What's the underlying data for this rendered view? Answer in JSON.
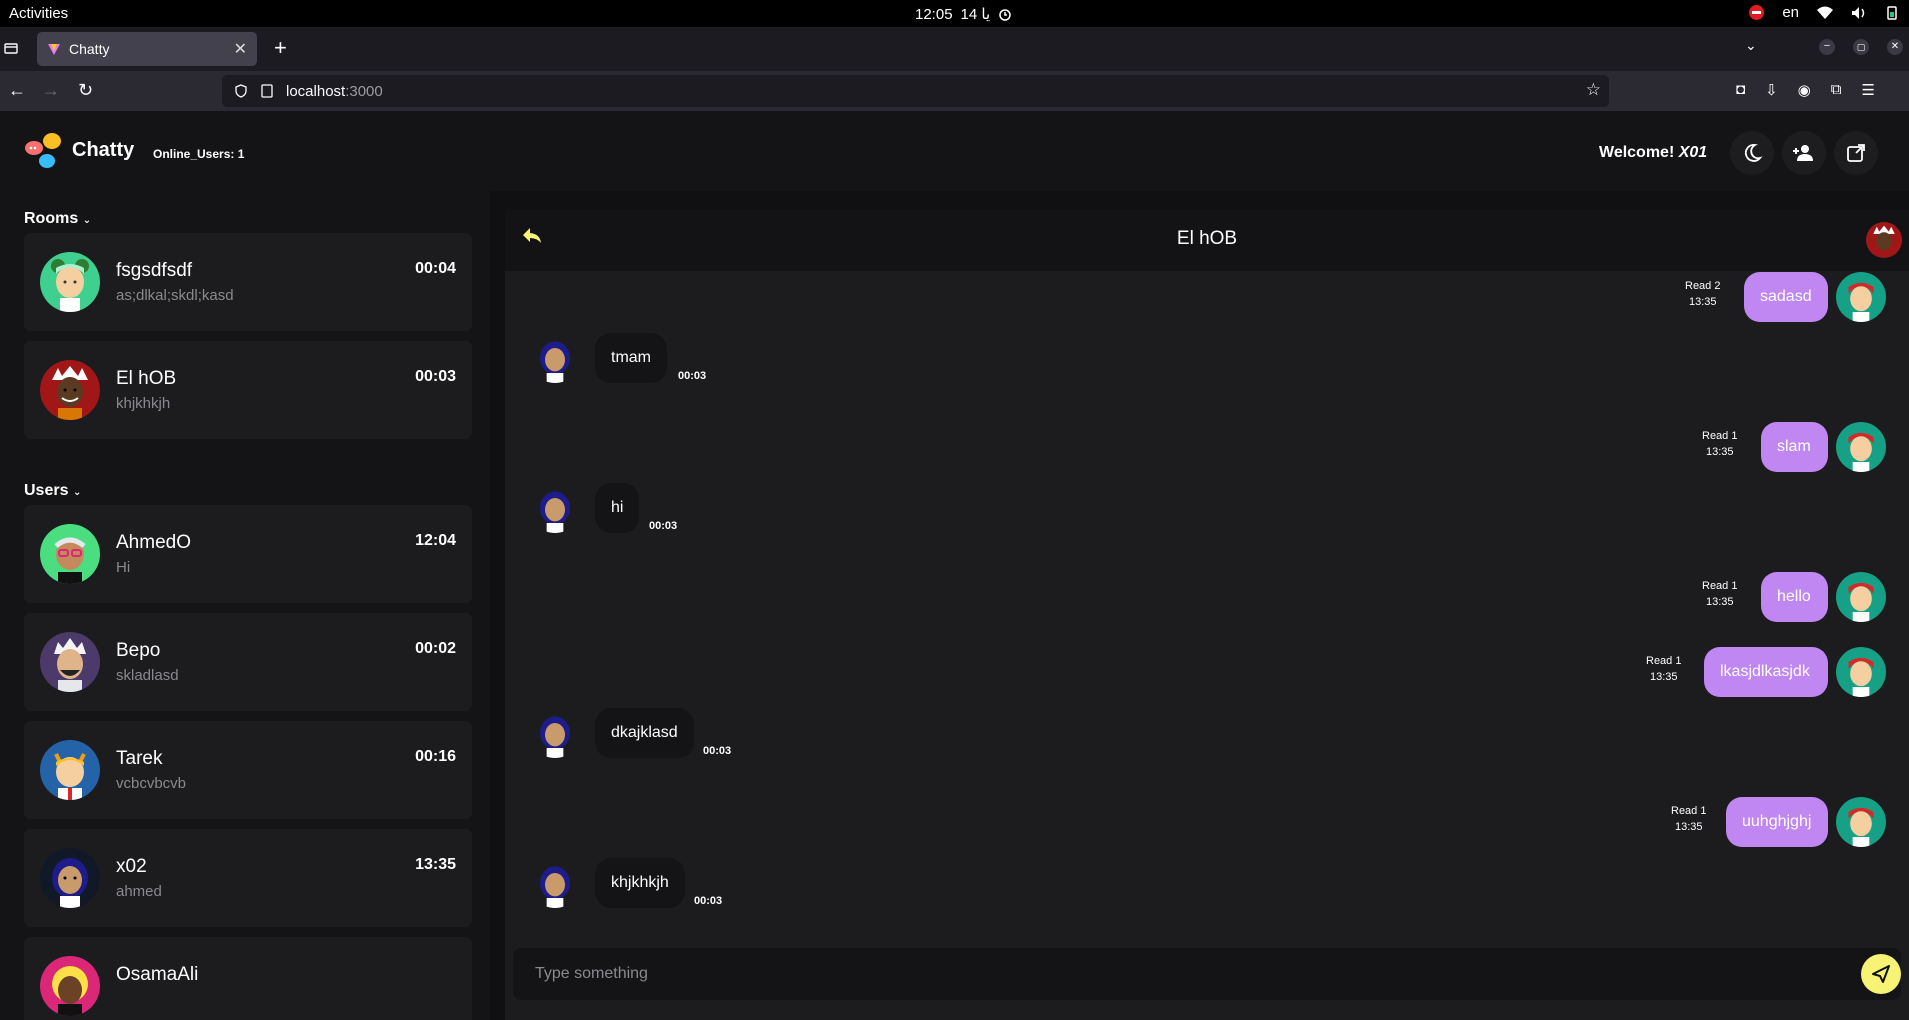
{
  "system": {
    "activities": "Activities",
    "time": "12:05",
    "date": "14 يا",
    "lang": "en"
  },
  "browser": {
    "tab_title": "Chatty",
    "url_host": "localhost",
    "url_port": ":3000"
  },
  "header": {
    "brand": "Chatty",
    "online_users": "Online_Users:  1",
    "welcome_prefix": "Welcome! ",
    "welcome_user": "X01"
  },
  "sidebar": {
    "rooms_title": "Rooms",
    "users_title": "Users",
    "rooms": [
      {
        "name": "fsgsdfsdf",
        "last": "as;dlkal;skdl;kasd",
        "time": "00:04"
      },
      {
        "name": "El hOB",
        "last": "khjkhkjh",
        "time": "00:03"
      }
    ],
    "users": [
      {
        "name": "AhmedO",
        "last": "Hi",
        "time": "12:04"
      },
      {
        "name": "Bepo",
        "last": "skladlasd",
        "time": "00:02"
      },
      {
        "name": "Tarek",
        "last": "vcbcvbcvb",
        "time": "00:16"
      },
      {
        "name": "x02",
        "last": "ahmed",
        "time": "13:35"
      },
      {
        "name": "OsamaAli",
        "last": "",
        "time": ""
      }
    ]
  },
  "chat": {
    "title": "El hOB",
    "input_placeholder": "Type something",
    "messages": [
      {
        "dir": "out",
        "text": "sadasd",
        "read": "Read 2",
        "time": "13:35"
      },
      {
        "dir": "in",
        "text": "tmam",
        "time": "00:03"
      },
      {
        "dir": "out",
        "text": "slam",
        "read": "Read 1",
        "time": "13:35"
      },
      {
        "dir": "in",
        "text": "hi",
        "time": "00:03"
      },
      {
        "dir": "out",
        "text": "hello",
        "read": "Read 1",
        "time": "13:35"
      },
      {
        "dir": "out",
        "text": "lkasjdlkasjdk",
        "read": "Read 1",
        "time": "13:35"
      },
      {
        "dir": "in",
        "text": "dkajklasd",
        "time": "00:03"
      },
      {
        "dir": "out",
        "text": "uuhghjghj",
        "read": "Read 1",
        "time": "13:35"
      },
      {
        "dir": "in",
        "text": "khjkhkjh",
        "time": "00:03"
      }
    ]
  },
  "colors": {
    "accent_bubble": "#c086f2",
    "send_button": "#f6f375",
    "background": "#101012"
  }
}
